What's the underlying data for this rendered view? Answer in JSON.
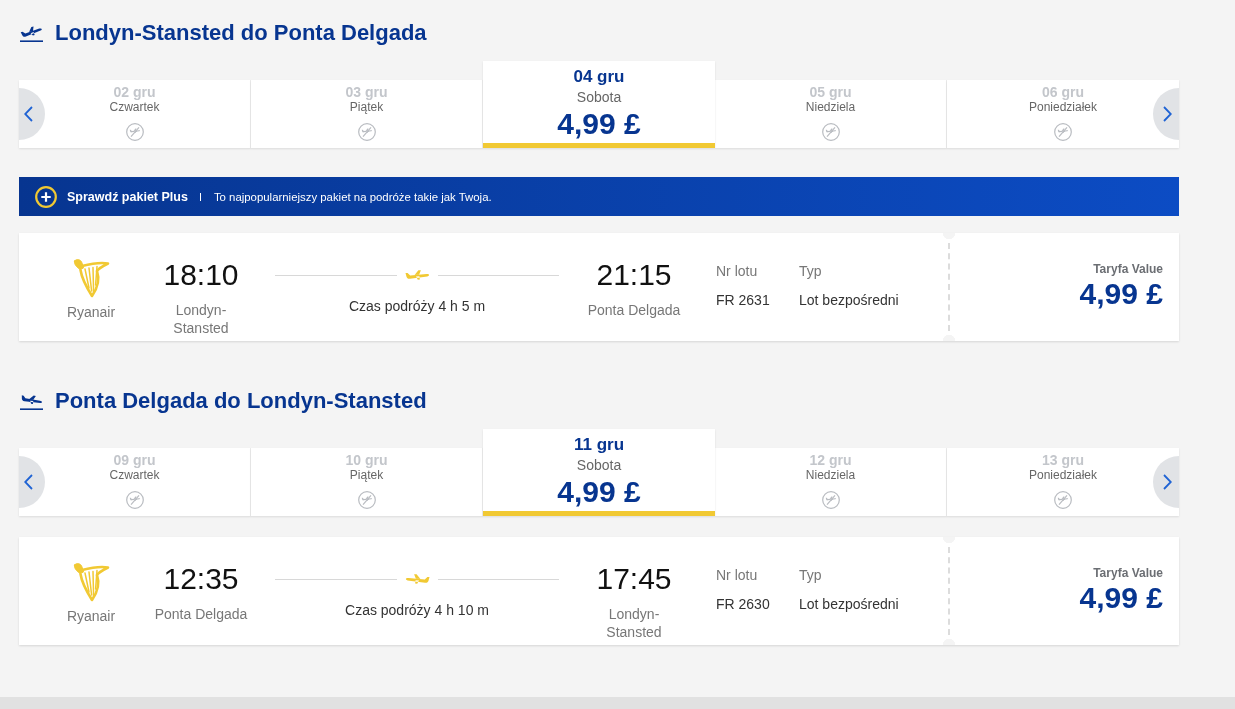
{
  "sections": [
    {
      "kind": "outbound",
      "title": "Londyn-Stansted do Ponta Delgada",
      "dates": [
        {
          "date": "02 gru",
          "day": "Czwartek",
          "available": false,
          "selected": false
        },
        {
          "date": "03 gru",
          "day": "Piątek",
          "available": false,
          "selected": false
        },
        {
          "date": "04 gru",
          "day": "Sobota",
          "available": true,
          "price": "4,99 £",
          "selected": true
        },
        {
          "date": "05 gru",
          "day": "Niedziela",
          "available": false,
          "selected": false
        },
        {
          "date": "06 gru",
          "day": "Poniedziałek",
          "available": false,
          "selected": false
        }
      ],
      "banner": {
        "title": "Sprawdź pakiet Plus",
        "text": "To najpopularniejszy pakiet na podróże takie jak Twoja."
      },
      "flight": {
        "airline": "Ryanair",
        "departure_time": "18:10",
        "departure_airport": "Londyn-Stansted",
        "duration": "Czas podróży 4 h 5 m",
        "arrival_time": "21:15",
        "arrival_airport": "Ponta Delgada",
        "flight_number_label": "Nr lotu",
        "flight_number": "FR 2631",
        "type_label": "Typ",
        "type": "Lot bezpośredni",
        "fare_label": "Taryfa Value",
        "price": "4,99 £"
      }
    },
    {
      "kind": "return",
      "title": "Ponta Delgada do Londyn-Stansted",
      "dates": [
        {
          "date": "09 gru",
          "day": "Czwartek",
          "available": false,
          "selected": false
        },
        {
          "date": "10 gru",
          "day": "Piątek",
          "available": false,
          "selected": false
        },
        {
          "date": "11 gru",
          "day": "Sobota",
          "available": true,
          "price": "4,99 £",
          "selected": true
        },
        {
          "date": "12 gru",
          "day": "Niedziela",
          "available": false,
          "selected": false
        },
        {
          "date": "13 gru",
          "day": "Poniedziałek",
          "available": false,
          "selected": false
        }
      ],
      "flight": {
        "airline": "Ryanair",
        "departure_time": "12:35",
        "departure_airport": "Ponta Delgada",
        "duration": "Czas podróży 4 h 10 m",
        "arrival_time": "17:45",
        "arrival_airport": "Londyn-Stansted",
        "flight_number_label": "Nr lotu",
        "flight_number": "FR 2630",
        "type_label": "Typ",
        "type": "Lot bezpośredni",
        "fare_label": "Taryfa Value",
        "price": "4,99 £"
      }
    }
  ]
}
